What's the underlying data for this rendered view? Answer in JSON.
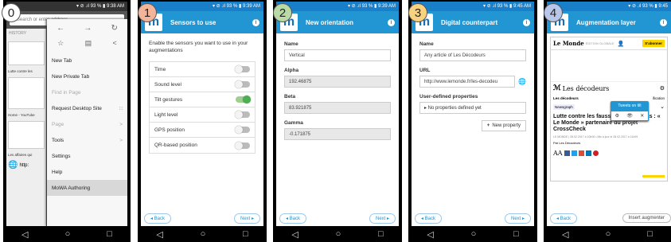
{
  "steps": [
    "0",
    "1",
    "2",
    "3",
    "4"
  ],
  "nav": {
    "back": "◁",
    "home": "○",
    "recent": "□"
  },
  "status": {
    "p0": "  ▾ ⊘ .ıl 93 % ▮ 9:38 AM",
    "p1": "  ▾ ⊘ .ıl 93 % ▮ 9:39 AM",
    "p2": "  ▾ ⊘ .ıl 93 % ▮ 9:39 AM",
    "p3": "  ▾ ⊘ .ıl 93 % ▮ 9:45 AM",
    "p4": "  ▾ ⊘ .ıl 93 % ▮ 9:45"
  },
  "p0": {
    "search_placeholder": "Search or enter address",
    "history_label": "HISTORY",
    "menu": [
      {
        "label": "New Tab",
        "extra": "",
        "dim": false
      },
      {
        "label": "New Private Tab",
        "extra": "",
        "dim": false
      },
      {
        "label": "Find in Page",
        "extra": "",
        "dim": true
      },
      {
        "label": "Request Desktop Site",
        "extra": "□",
        "dim": false
      },
      {
        "label": "Page",
        "extra": ">",
        "dim": true
      },
      {
        "label": "Tools",
        "extra": ">",
        "dim": false
      },
      {
        "label": "Settings",
        "extra": "",
        "dim": false
      },
      {
        "label": "Help",
        "extra": "",
        "dim": false
      },
      {
        "label": "MoWA Authoring",
        "extra": "",
        "dim": false
      }
    ],
    "bg_snippets": [
      "Lutte contre les",
      "Home - YouTube",
      "Les affaires qui",
      "http:"
    ]
  },
  "p1": {
    "title": "Sensors to use",
    "intro": "Enable the sensors you want to use in your augmentations",
    "sensors": [
      {
        "label": "Time",
        "on": false
      },
      {
        "label": "Sound level",
        "on": false
      },
      {
        "label": "Tilt gestures",
        "on": true
      },
      {
        "label": "Light level",
        "on": false
      },
      {
        "label": "GPS position",
        "on": false
      },
      {
        "label": "QR-based position",
        "on": false
      }
    ],
    "back": "◂ Back",
    "next": "Next ▸"
  },
  "p2": {
    "title": "New orientation",
    "fields": [
      {
        "label": "Name",
        "value": "Vertical",
        "grey": false
      },
      {
        "label": "Alpha",
        "value": "192.46875",
        "grey": true
      },
      {
        "label": "Beta",
        "value": "83.921875",
        "grey": true
      },
      {
        "label": "Gamma",
        "value": "-0.171875",
        "grey": true
      }
    ],
    "back": "◂ Back",
    "next": "Next ▸"
  },
  "p3": {
    "title": "Digital counterpart",
    "name_label": "Name",
    "name_value": "Any article of Les Décodeurs",
    "url_label": "URL",
    "url_value": "http://www.lemonde.fr/les-decodeu",
    "props_label": "User-defined properties",
    "props_value": "▸ No properties defined yet",
    "new_prop": "New property",
    "back": "◂ Back",
    "next": "Next ▸"
  },
  "p4": {
    "title": "Augmentation layer",
    "lemonde": "Le Monde",
    "edition": "ÉDITION GLOBALE",
    "subscribe": "S'abonner",
    "decodeurs": "Les décodeurs",
    "tooltip": "Tweets on tilt",
    "tool_icons": [
      "⚙",
      "👁",
      "✕"
    ],
    "tag1": "Les décodeurs",
    "tag2": "Newsgraph",
    "tag_side": "ification",
    "headline": "Lutte contre les fausses informations : « Le Monde » partenaire du projet CrossCheck",
    "meta": "LE MONDE | 28.02.2017 à 10h06 • Mis à jour le 28.02.2017 à 11h09",
    "byline": "Par Les Décodeurs",
    "aa": "AA",
    "back": "◂ Back",
    "insert": "Insert augmenter"
  }
}
